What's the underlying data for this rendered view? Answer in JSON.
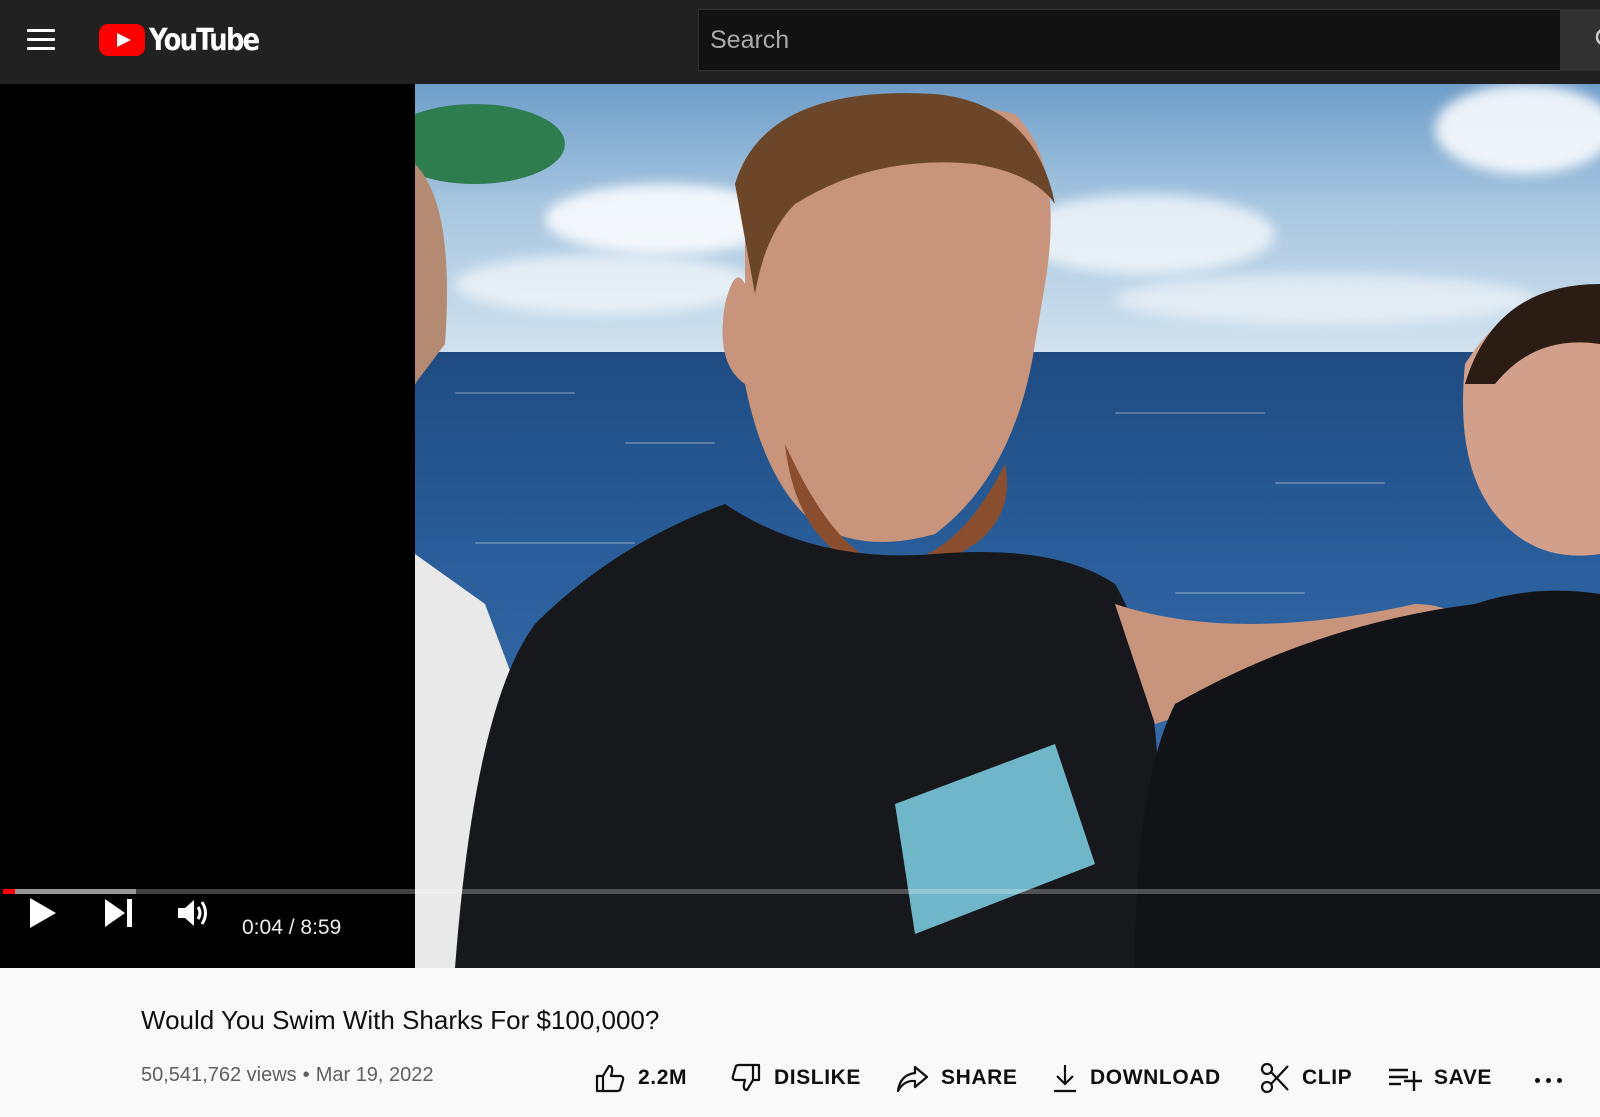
{
  "app": {
    "logo_text": "YouTube",
    "brand_color": "#ff0000"
  },
  "header": {
    "search_placeholder": "Search",
    "icons": [
      "menu-icon",
      "youtube-logo-icon",
      "search-icon"
    ]
  },
  "player": {
    "current_time": "0:04",
    "separator": " / ",
    "duration": "8:59",
    "played_fraction": 0.0074,
    "buffered_fraction": 0.083,
    "icons": [
      "play-icon",
      "next-icon",
      "volume-icon"
    ]
  },
  "video": {
    "title": "Would You Swim With Sharks For $100,000?",
    "views": "50,541,762 views",
    "date": "Mar 19, 2022"
  },
  "actions": {
    "like_count": "2.2M",
    "dislike_label": "DISLIKE",
    "share_label": "SHARE",
    "download_label": "DOWNLOAD",
    "clip_label": "CLIP",
    "save_label": "SAVE"
  }
}
